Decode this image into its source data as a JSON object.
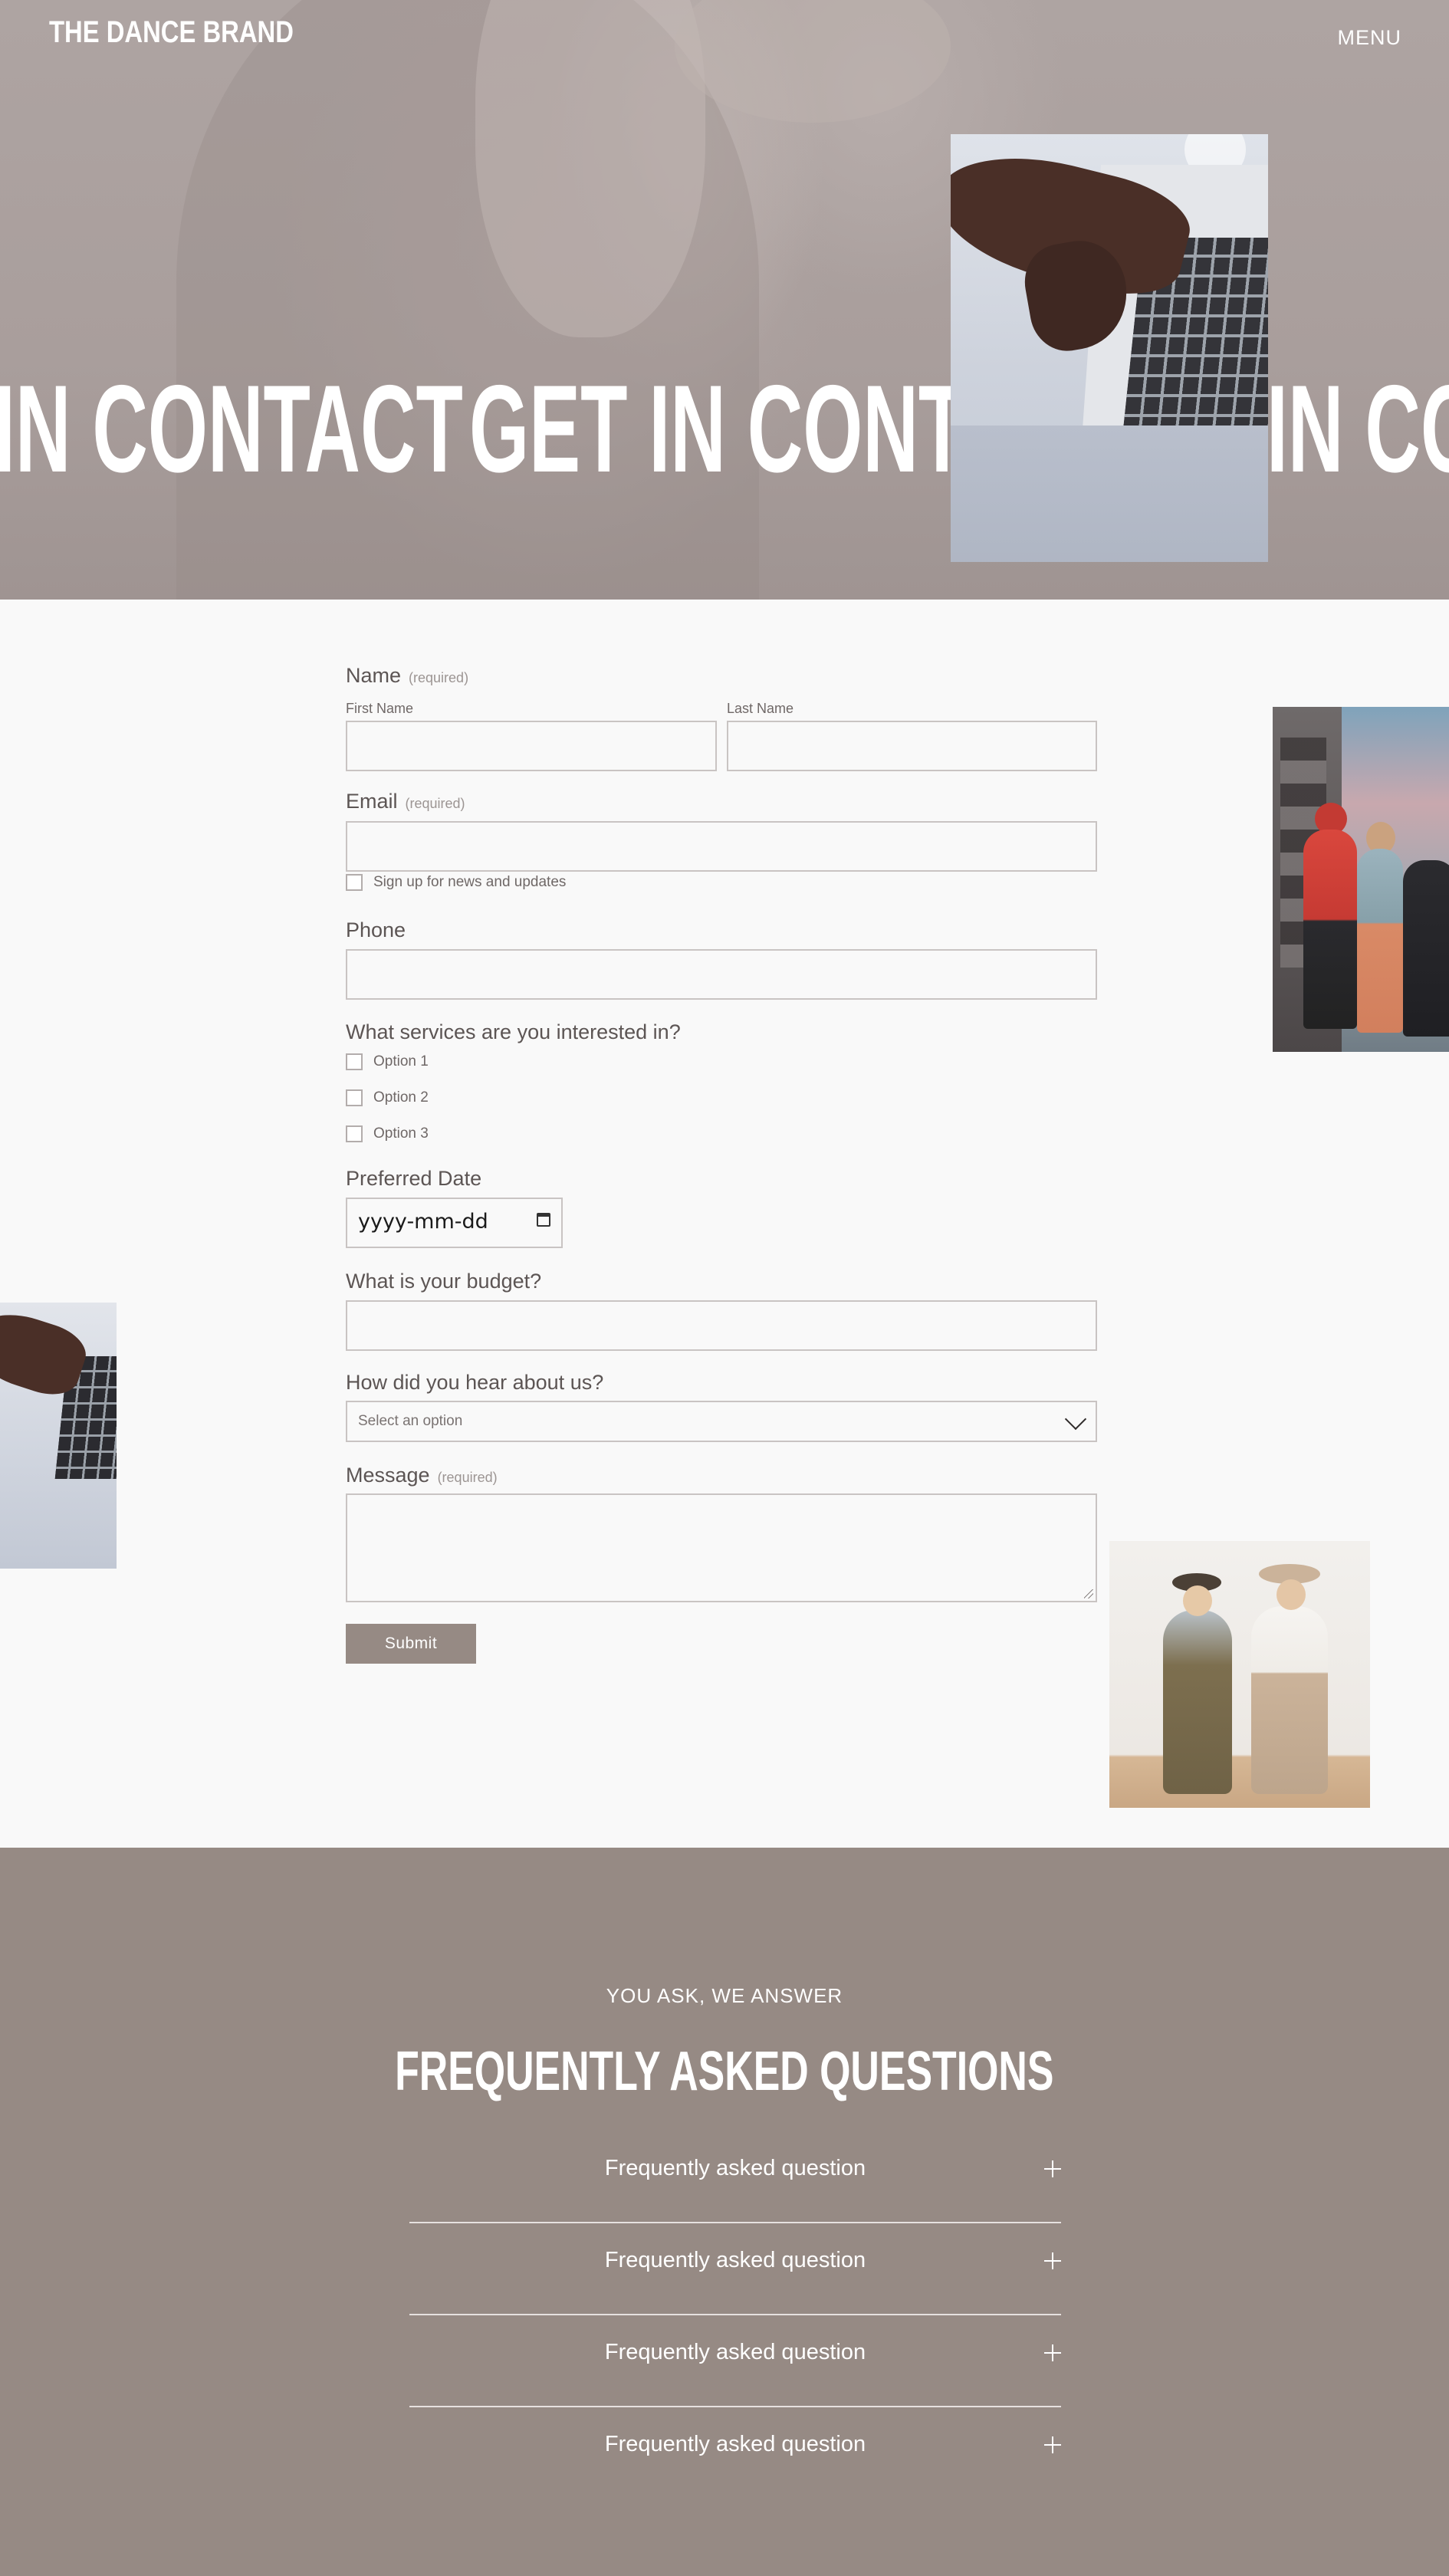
{
  "header": {
    "brand": "THE DANCE BRAND",
    "menu_label": "MENU"
  },
  "hero": {
    "marquee": [
      "IN CONTACT",
      "GET IN CONTA",
      "IN CO"
    ]
  },
  "form": {
    "name": {
      "label": "Name",
      "required": "(required)",
      "first_label": "First Name",
      "last_label": "Last Name",
      "first_value": "",
      "last_value": ""
    },
    "email": {
      "label": "Email",
      "required": "(required)",
      "value": "",
      "newsletter_label": "Sign up for news and updates"
    },
    "phone": {
      "label": "Phone",
      "value": ""
    },
    "services": {
      "label": "What services are you interested in?",
      "options": [
        "Option 1",
        "Option 2",
        "Option 3"
      ]
    },
    "date": {
      "label": "Preferred Date",
      "placeholder": "yyyy-mm-dd"
    },
    "budget": {
      "label": "What is your budget?",
      "value": ""
    },
    "source": {
      "label": "How did you hear about us?",
      "selected": "Select an option"
    },
    "message": {
      "label": "Message",
      "required": "(required)",
      "value": ""
    },
    "submit_label": "Submit"
  },
  "faq": {
    "eyebrow": "YOU ASK, WE ANSWER",
    "title": "FREQUENTLY ASKED QUESTIONS",
    "items": [
      "Frequently asked question",
      "Frequently asked question",
      "Frequently asked question",
      "Frequently asked question"
    ]
  },
  "colors": {
    "accent": "#968a84",
    "hero_overlay": "#aba09e",
    "page_bg": "#f9f9f9",
    "text": "#5c5554"
  },
  "icons": {
    "date_picker": "calendar-icon",
    "select": "chevron-down-icon",
    "faq_toggle": "plus-icon"
  }
}
